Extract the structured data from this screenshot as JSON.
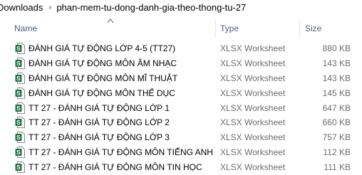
{
  "breadcrumb": {
    "items": [
      "Downloads",
      "phan-mem-tu-dong-danh-gia-theo-thong-tu-27"
    ],
    "separator": "›"
  },
  "columns": {
    "name": "Name",
    "type": "Type",
    "size": "Size"
  },
  "sort": {
    "column": "name",
    "direction": "ascending"
  },
  "file_icon": "excel-file-icon",
  "colors": {
    "excel_green": "#1d7044",
    "header_text": "#4c607a",
    "meta_text": "#6d6d6d"
  },
  "files": [
    {
      "name": "ĐÁNH GIÁ TỰ ĐỘNG LỚP 4-5 (TT27)",
      "type": "XLSX Worksheet",
      "size": "880 KB"
    },
    {
      "name": "ĐÁNH GIÁ TỰ ĐỘNG MÔN ÂM NHẠC",
      "type": "XLSX Worksheet",
      "size": "143 KB"
    },
    {
      "name": "ĐÁNH GIÁ TỰ ĐỘNG MÔN MĨ THUẬT",
      "type": "XLSX Worksheet",
      "size": "143 KB"
    },
    {
      "name": "ĐÁNH GIÁ TỰ ĐỘNG MÔN THỂ DỤC",
      "type": "XLSX Worksheet",
      "size": "145 KB"
    },
    {
      "name": "TT 27 - ĐÁNH GIÁ TỰ ĐỘNG LỚP 1",
      "type": "XLSX Worksheet",
      "size": "647 KB"
    },
    {
      "name": "TT 27 - ĐÁNH GIÁ TỰ ĐỘNG LỚP 2",
      "type": "XLSX Worksheet",
      "size": "660 KB"
    },
    {
      "name": "TT 27 - ĐÁNH GIÁ TỰ ĐỘNG LỚP 3",
      "type": "XLSX Worksheet",
      "size": "757 KB"
    },
    {
      "name": "TT 27 - ĐÁNH GIÁ TỰ ĐỘNG MÔN TIẾNG ANH",
      "type": "XLSX Worksheet",
      "size": "112 KB"
    },
    {
      "name": "TT 27 - ĐÁNH GIÁ TỰ ĐỘNG MÔN TIN HỌC",
      "type": "XLSX Worksheet",
      "size": "111 KB"
    }
  ]
}
